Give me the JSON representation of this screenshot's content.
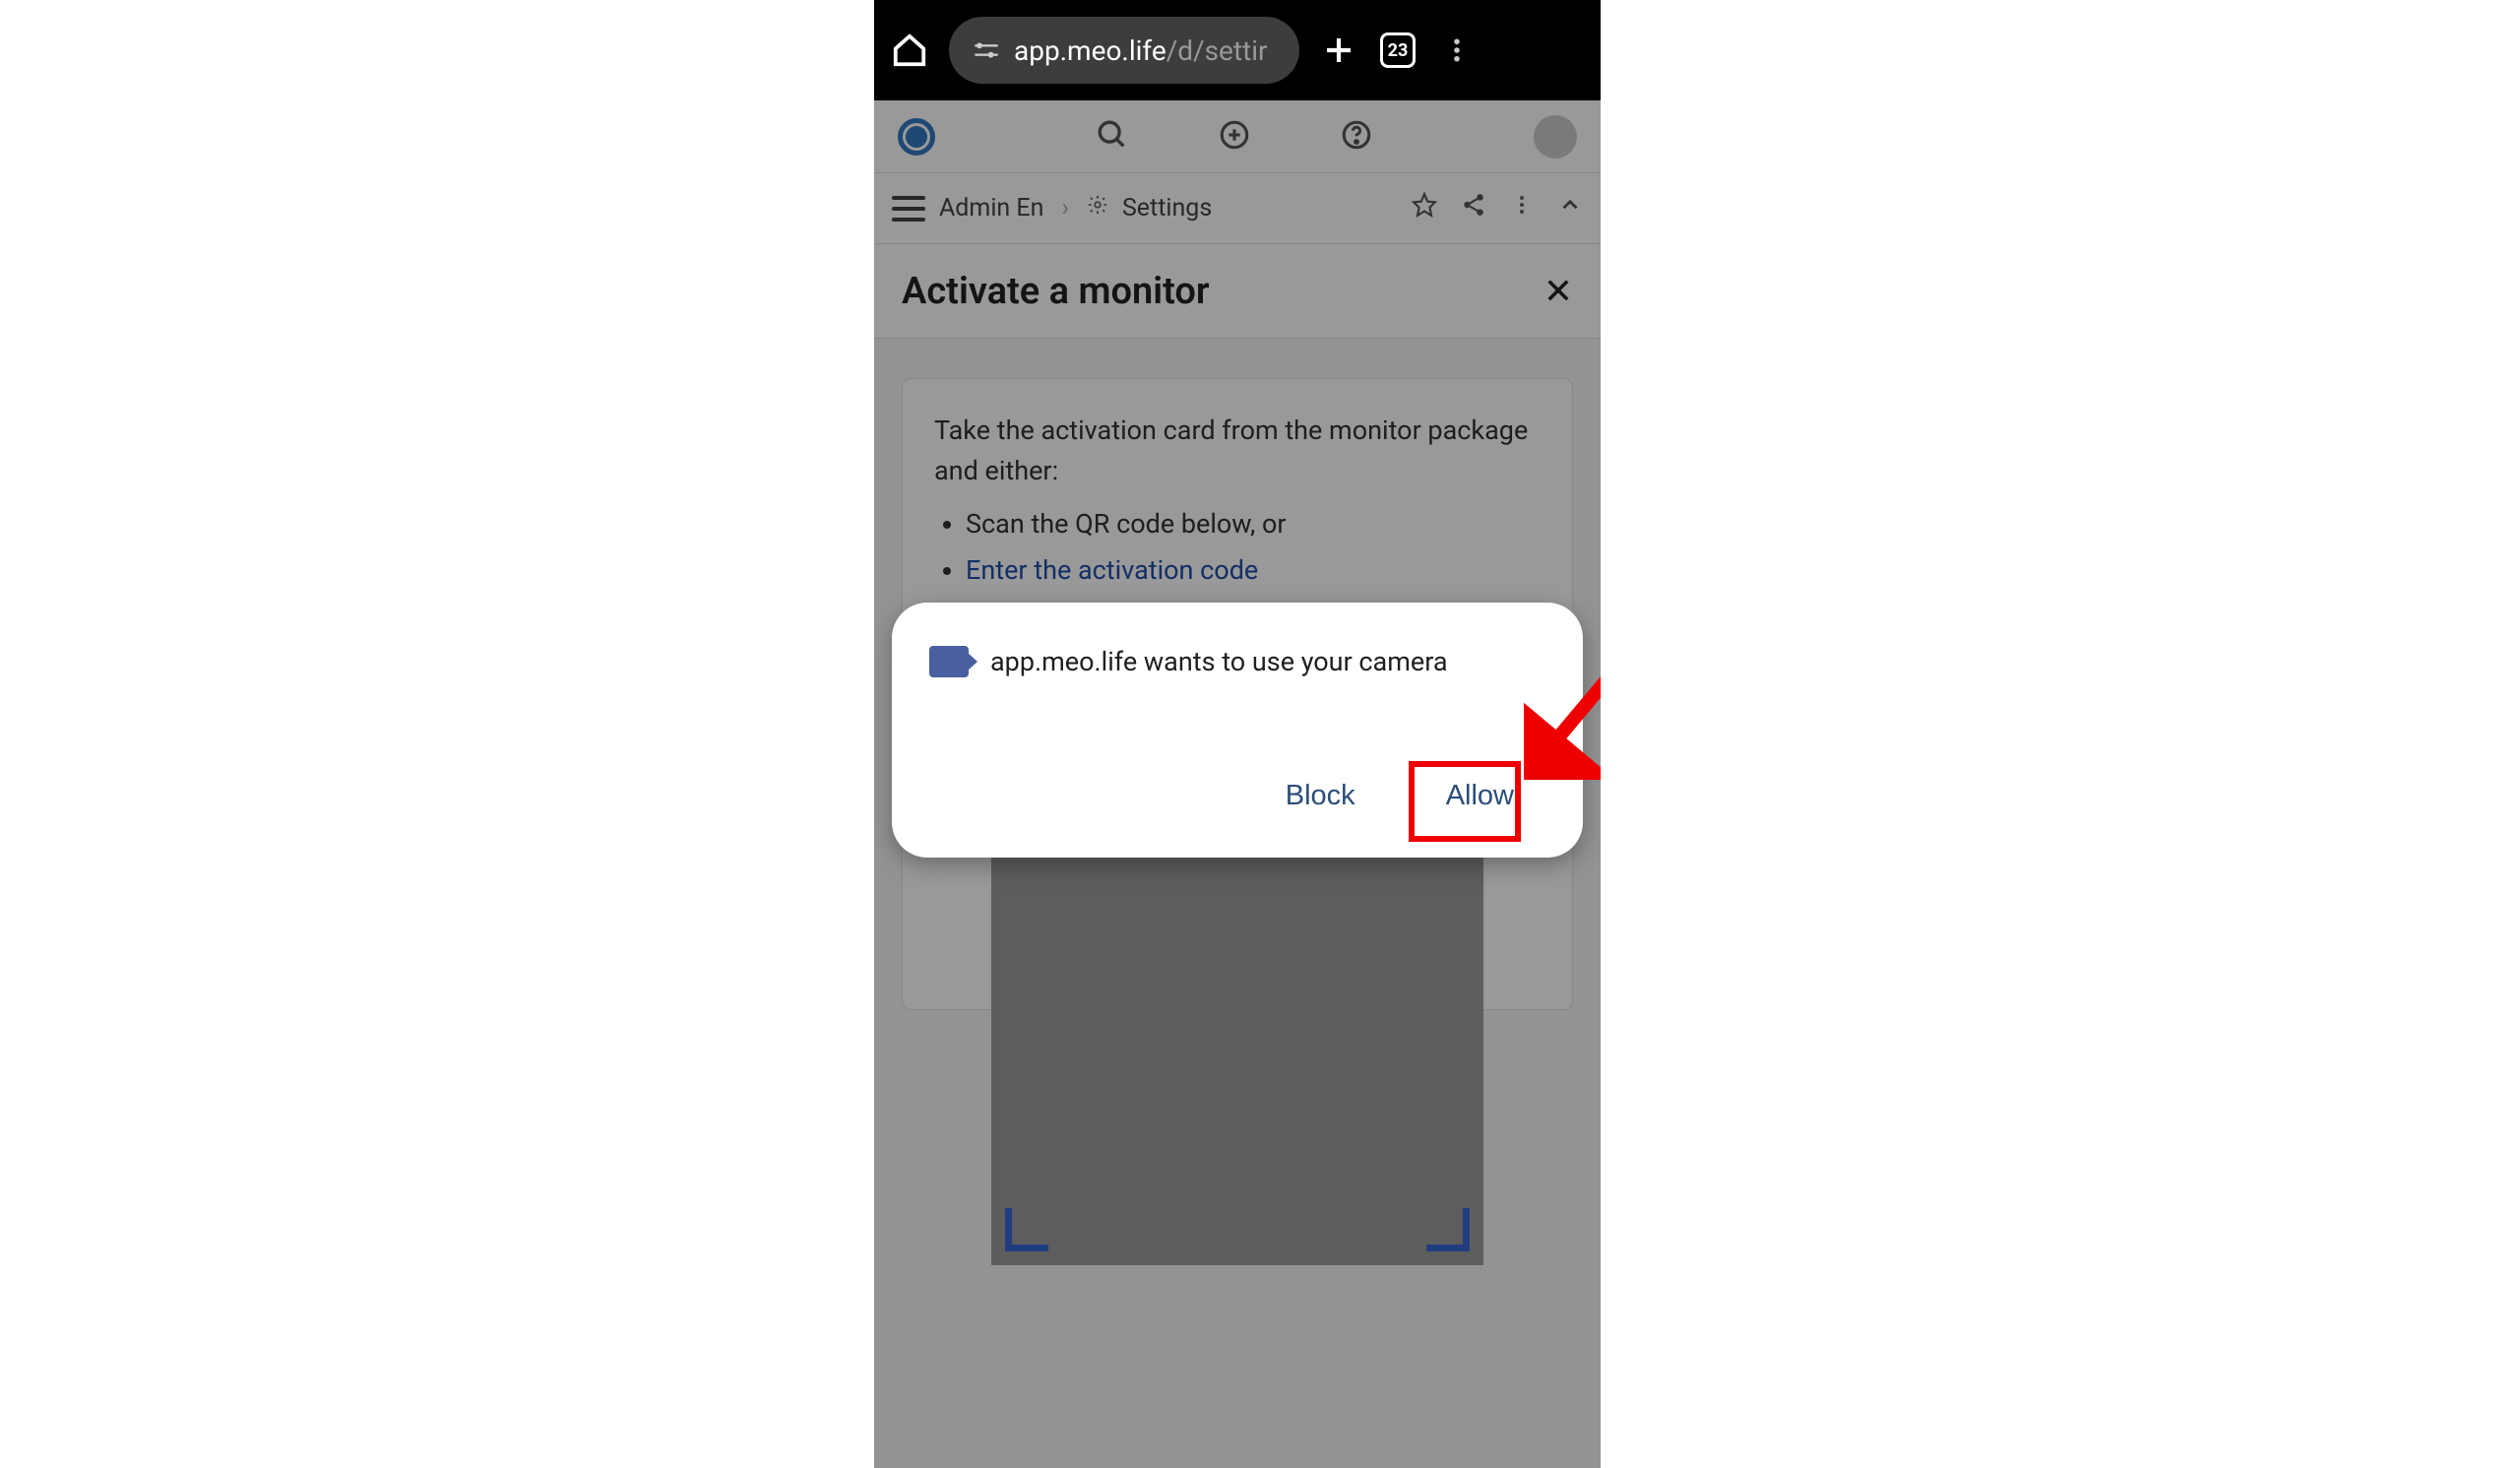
{
  "browser": {
    "url_host": "app.meo.life",
    "url_path": "/d/settir",
    "tab_count": "23"
  },
  "breadcrumb": {
    "item1": "Admin En",
    "item2": "Settings"
  },
  "panel": {
    "title": "Activate a monitor"
  },
  "instruction": {
    "intro": "Take the activation card from the monitor package and either:",
    "bullet1": "Scan the QR code below, or",
    "bullet2_link": "Enter the activation code"
  },
  "permission": {
    "message": "app.meo.life wants to use your camera",
    "block_label": "Block",
    "allow_label": "Allow"
  }
}
